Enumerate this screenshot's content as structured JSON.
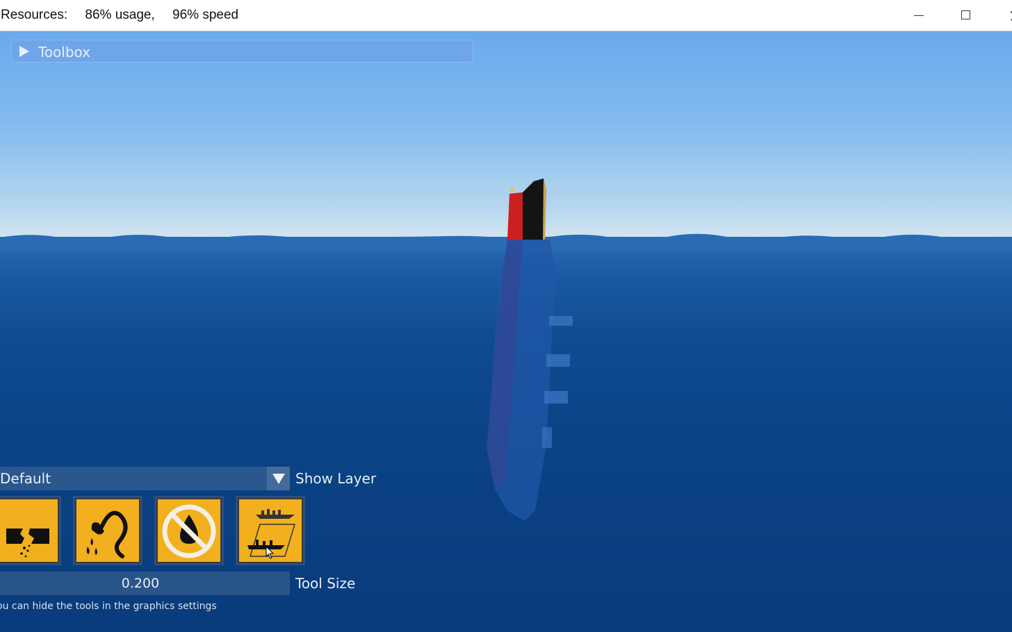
{
  "window": {
    "resources_label": "Resources:",
    "usage": "86% usage,",
    "speed": "96% speed"
  },
  "toolbox": {
    "label": "Toolbox",
    "expanded": false
  },
  "layer": {
    "selected": "Default",
    "label": "Show Layer"
  },
  "tools": [
    {
      "name": "break-tool",
      "icon": "broken-hull-icon"
    },
    {
      "name": "water-pour-tool",
      "icon": "pour-water-icon"
    },
    {
      "name": "no-water-tool",
      "icon": "no-water-icon"
    },
    {
      "name": "move-ship-tool",
      "icon": "ship-tilt-icon"
    }
  ],
  "tool_size": {
    "value": "0.200",
    "label": "Tool Size"
  },
  "hint": "ou can hide the tools in the graphics settings",
  "colors": {
    "tool_yellow": "#f2b01e",
    "sky_top": "#6aa9ec",
    "sea_deep": "#083b7b",
    "funnel_red": "#cc1f1f",
    "hull_black": "#141414"
  }
}
